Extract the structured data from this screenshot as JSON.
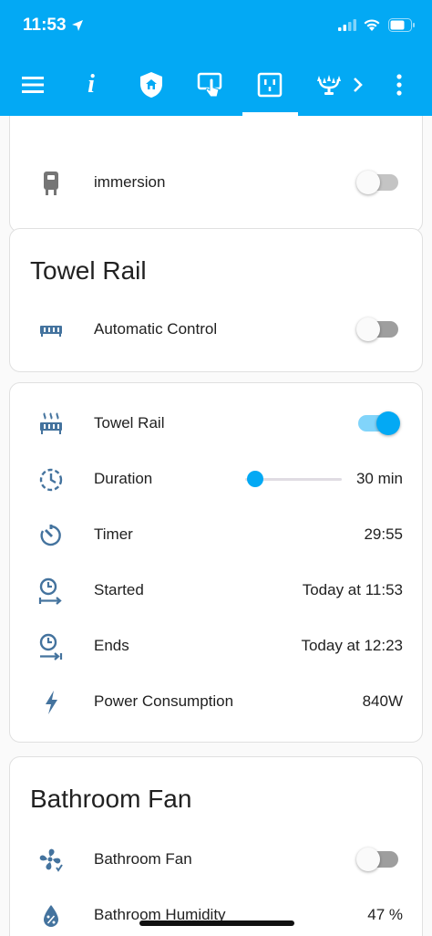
{
  "status_bar": {
    "time": "11:53"
  },
  "toolbar": {
    "items": [
      {
        "icon": "menu-icon"
      },
      {
        "icon": "info-icon",
        "label": "i"
      },
      {
        "icon": "home-shield-icon"
      },
      {
        "icon": "touch-panel-icon"
      },
      {
        "icon": "power-socket-icon",
        "active": true
      },
      {
        "icon": "chandelier-icon"
      },
      {
        "icon": "chevron-right-icon"
      },
      {
        "icon": "more-vertical-icon"
      }
    ],
    "accent": "#03a9f4"
  },
  "cards": {
    "immersion_card": {
      "rows": [
        {
          "label": "immersion",
          "icon": "water-heater-icon",
          "state": "off"
        }
      ]
    },
    "towel_rail_auto": {
      "title": "Towel Rail",
      "rows": [
        {
          "label": "Automatic Control",
          "icon": "radiator-icon",
          "state": "off"
        }
      ]
    },
    "towel_rail_detail": {
      "rows": [
        {
          "label": "Towel Rail",
          "icon": "radiator-heat-icon",
          "state": "on"
        },
        {
          "label": "Duration",
          "icon": "timer-dashed-icon",
          "value": "30 min",
          "slider_fraction": 0.02
        },
        {
          "label": "Timer",
          "icon": "timer-icon",
          "value": "29:55"
        },
        {
          "label": "Started",
          "icon": "clock-start-icon",
          "value": "Today at 11:53"
        },
        {
          "label": "Ends",
          "icon": "clock-end-icon",
          "value": "Today at 12:23"
        },
        {
          "label": "Power Consumption",
          "icon": "flash-icon",
          "value": "840W"
        }
      ]
    },
    "bathroom_fan": {
      "title": "Bathroom Fan",
      "rows": [
        {
          "label": "Bathroom Fan",
          "icon": "fan-icon",
          "state": "off"
        },
        {
          "label": "Bathroom Humidity",
          "icon": "water-percent-icon",
          "value": "47 %"
        }
      ]
    }
  },
  "colors": {
    "header": "#03a9f4",
    "icon": "#44739e",
    "toggle_on": "#03a9f4"
  }
}
